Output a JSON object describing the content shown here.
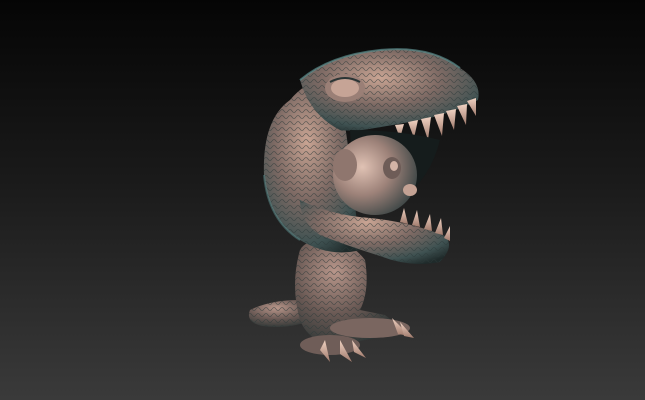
{
  "scene": {
    "subject": "sculpted-3d-model",
    "model_icon": "dinosaur-costume-figure-icon",
    "colors": {
      "background_top": "#050505",
      "background_bottom": "#3a3a3a",
      "material_highlight": "#d9b3a0",
      "material_mid": "#8a6f66",
      "material_shadow": "#2a3a3a",
      "material_cyan_tint": "#5a8c8c"
    }
  }
}
